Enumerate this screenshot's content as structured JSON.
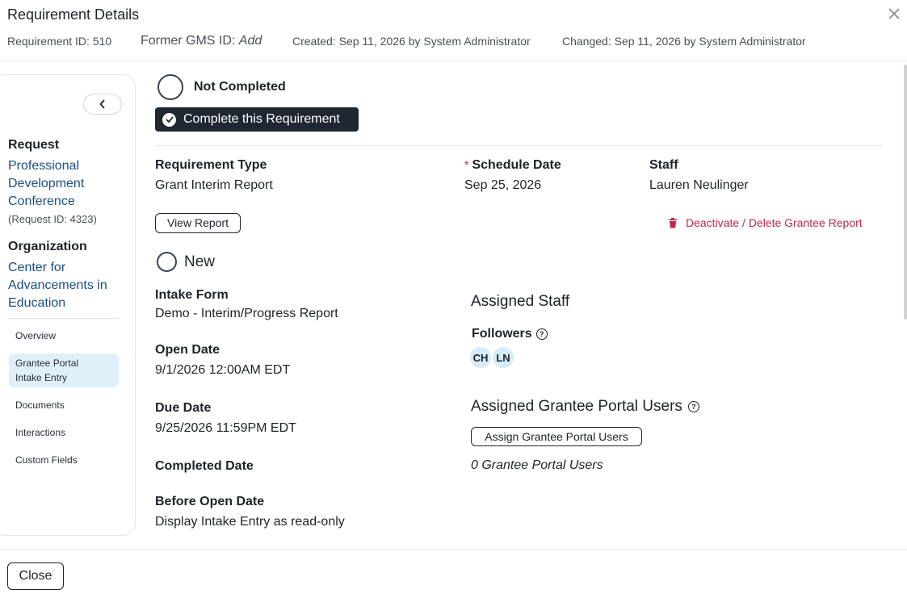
{
  "header": {
    "title": "Requirement Details",
    "requirement_id": "Requirement ID: 510",
    "former_gms_label": "Former GMS ID:",
    "former_gms_value": "Add",
    "created": "Created: Sep 11, 2026 by System Administrator",
    "changed": "Changed: Sep 11, 2026 by System Administrator"
  },
  "sidebar": {
    "request_label": "Request",
    "request_name_lines": [
      "Professional",
      "Development",
      "Conference"
    ],
    "request_id": "(Request ID: 4323)",
    "organization_label": "Organization",
    "organization_name_lines": [
      "Center for",
      "Advancements in",
      "Education"
    ],
    "nav": [
      {
        "label": "Overview"
      },
      {
        "label_lines": [
          "Grantee Portal",
          "Intake Entry"
        ]
      },
      {
        "label": "Documents"
      },
      {
        "label": "Interactions"
      },
      {
        "label": "Custom Fields"
      }
    ]
  },
  "requirement": {
    "status": "Not Completed",
    "complete_button": "Complete this Requirement",
    "type_label": "Requirement Type",
    "type_value": "Grant Interim Report",
    "schedule_label": "Schedule Date",
    "schedule_value": "Sep 25, 2026",
    "staff_label": "Staff",
    "staff_value": "Lauren Neulinger",
    "view_report_button": "View Report",
    "deactivate_link": "Deactivate / Delete Grantee Report"
  },
  "intake": {
    "status": "New",
    "form_label": "Intake Form",
    "form_value": "Demo - Interim/Progress Report",
    "open_label": "Open Date",
    "open_value": "9/1/2026 12:00AM EDT",
    "due_label": "Due Date",
    "due_value": "9/25/2026 11:59PM EDT",
    "completed_label": "Completed Date",
    "before_open_label": "Before Open Date",
    "before_open_value": "Display Intake Entry as read-only"
  },
  "assigned": {
    "staff_heading": "Assigned Staff",
    "followers_label": "Followers",
    "followers": [
      "CH",
      "LN"
    ],
    "portal_heading": "Assigned Grantee Portal Users",
    "assign_button": "Assign Grantee Portal Users",
    "portal_count": "0 Grantee Portal Users"
  },
  "footer": {
    "close_button": "Close"
  },
  "colors": {
    "link": "#1a4f86",
    "danger": "#c0284e",
    "primary_button": "#1f2732",
    "active_nav": "#dff0fb",
    "avatar": "#d7ecfa"
  }
}
